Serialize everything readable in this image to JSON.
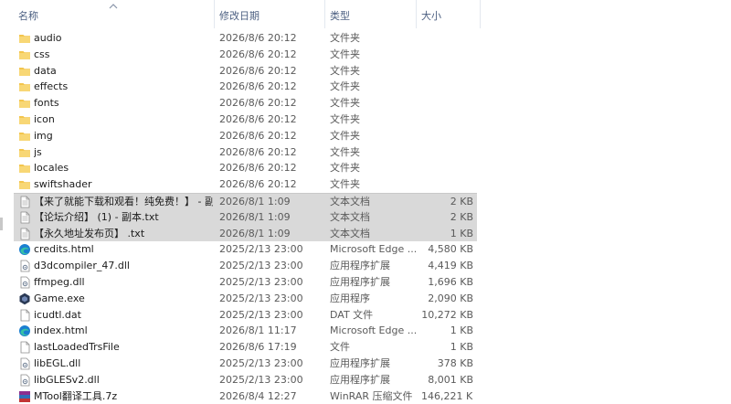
{
  "header": {
    "name": "名称",
    "date": "修改日期",
    "type": "类型",
    "size": "大小"
  },
  "files": [
    {
      "name": "audio",
      "date": "2026/8/6 20:12",
      "type": "文件夹",
      "size": "",
      "icon": "folder-icon"
    },
    {
      "name": "css",
      "date": "2026/8/6 20:12",
      "type": "文件夹",
      "size": "",
      "icon": "folder-icon"
    },
    {
      "name": "data",
      "date": "2026/8/6 20:12",
      "type": "文件夹",
      "size": "",
      "icon": "folder-icon"
    },
    {
      "name": "effects",
      "date": "2026/8/6 20:12",
      "type": "文件夹",
      "size": "",
      "icon": "folder-icon"
    },
    {
      "name": "fonts",
      "date": "2026/8/6 20:12",
      "type": "文件夹",
      "size": "",
      "icon": "folder-icon"
    },
    {
      "name": "icon",
      "date": "2026/8/6 20:12",
      "type": "文件夹",
      "size": "",
      "icon": "folder-icon"
    },
    {
      "name": "img",
      "date": "2026/8/6 20:12",
      "type": "文件夹",
      "size": "",
      "icon": "folder-icon"
    },
    {
      "name": "js",
      "date": "2026/8/6 20:12",
      "type": "文件夹",
      "size": "",
      "icon": "folder-icon"
    },
    {
      "name": "locales",
      "date": "2026/8/6 20:12",
      "type": "文件夹",
      "size": "",
      "icon": "folder-icon"
    },
    {
      "name": "swiftshader",
      "date": "2026/8/6 20:12",
      "type": "文件夹",
      "size": "",
      "icon": "folder-icon"
    },
    {
      "name": "【来了就能下载和观看！纯免费！】 - 副...",
      "date": "2026/8/1 1:09",
      "type": "文本文档",
      "size": "2 KB",
      "icon": "text-file-icon",
      "selected": true
    },
    {
      "name": "【论坛介绍】 (1) - 副本.txt",
      "date": "2026/8/1 1:09",
      "type": "文本文档",
      "size": "2 KB",
      "icon": "text-file-icon",
      "selected": true
    },
    {
      "name": "【永久地址发布页】 .txt",
      "date": "2026/8/1 1:09",
      "type": "文本文档",
      "size": "1 KB",
      "icon": "text-file-icon",
      "selected": true
    },
    {
      "name": "credits.html",
      "date": "2025/2/13 23:00",
      "type": "Microsoft Edge ...",
      "size": "4,580 KB",
      "icon": "edge-icon"
    },
    {
      "name": "d3dcompiler_47.dll",
      "date": "2025/2/13 23:00",
      "type": "应用程序扩展",
      "size": "4,419 KB",
      "icon": "dll-icon"
    },
    {
      "name": "ffmpeg.dll",
      "date": "2025/2/13 23:00",
      "type": "应用程序扩展",
      "size": "1,696 KB",
      "icon": "dll-icon"
    },
    {
      "name": "Game.exe",
      "date": "2025/2/13 23:00",
      "type": "应用程序",
      "size": "2,090 KB",
      "icon": "game-exe-icon"
    },
    {
      "name": "icudtl.dat",
      "date": "2025/2/13 23:00",
      "type": "DAT 文件",
      "size": "10,272 KB",
      "icon": "file-icon"
    },
    {
      "name": "index.html",
      "date": "2026/8/1 11:17",
      "type": "Microsoft Edge ...",
      "size": "1 KB",
      "icon": "edge-icon"
    },
    {
      "name": "lastLoadedTrsFile",
      "date": "2026/8/6 17:19",
      "type": "文件",
      "size": "1 KB",
      "icon": "file-icon"
    },
    {
      "name": "libEGL.dll",
      "date": "2025/2/13 23:00",
      "type": "应用程序扩展",
      "size": "378 KB",
      "icon": "dll-icon"
    },
    {
      "name": "libGLESv2.dll",
      "date": "2025/2/13 23:00",
      "type": "应用程序扩展",
      "size": "8,001 KB",
      "icon": "dll-icon"
    },
    {
      "name": "MTool翻译工具.7z",
      "date": "2026/8/4 12:27",
      "type": "WinRAR 压缩文件",
      "size": "146,221 KB",
      "icon": "winrar-icon"
    }
  ],
  "colors": {
    "selected_row": "#d9d9d9",
    "header_text": "#4d6082",
    "folder": "#f3c54d",
    "edge": "#1a7fd1"
  }
}
